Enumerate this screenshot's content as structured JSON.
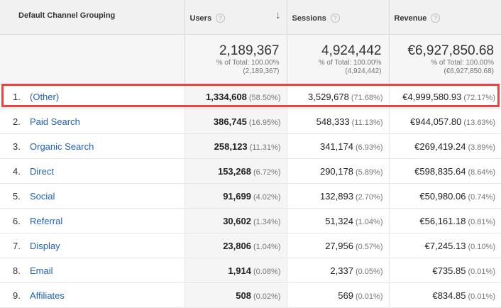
{
  "header": {
    "dimension": "Default Channel Grouping",
    "users": "Users",
    "sessions": "Sessions",
    "revenue": "Revenue",
    "help_glyph": "?",
    "sort_glyph": "↓"
  },
  "totals": {
    "users": {
      "value": "2,189,367",
      "pct": "% of Total: 100.00%",
      "abs": "(2,189,367)"
    },
    "sessions": {
      "value": "4,924,442",
      "pct": "% of Total: 100.00%",
      "abs": "(4,924,442)"
    },
    "revenue": {
      "value": "€6,927,850.68",
      "pct": "% of Total: 100.00%",
      "abs": "(€6,927,850.68)"
    }
  },
  "rows": [
    {
      "num": "1.",
      "channel": "(Other)",
      "users": "1,334,608",
      "users_pct": "(58.50%)",
      "sessions": "3,529,678",
      "sessions_pct": "(71.68%)",
      "revenue": "€4,999,580.93",
      "revenue_pct": "(72.17%)"
    },
    {
      "num": "2.",
      "channel": "Paid Search",
      "users": "386,745",
      "users_pct": "(16.95%)",
      "sessions": "548,333",
      "sessions_pct": "(11.13%)",
      "revenue": "€944,057.80",
      "revenue_pct": "(13.63%)"
    },
    {
      "num": "3.",
      "channel": "Organic Search",
      "users": "258,123",
      "users_pct": "(11.31%)",
      "sessions": "341,174",
      "sessions_pct": "(6.93%)",
      "revenue": "€269,419.24",
      "revenue_pct": "(3.89%)"
    },
    {
      "num": "4.",
      "channel": "Direct",
      "users": "153,268",
      "users_pct": "(6.72%)",
      "sessions": "290,178",
      "sessions_pct": "(5.89%)",
      "revenue": "€598,835.64",
      "revenue_pct": "(8.64%)"
    },
    {
      "num": "5.",
      "channel": "Social",
      "users": "91,699",
      "users_pct": "(4.02%)",
      "sessions": "132,893",
      "sessions_pct": "(2.70%)",
      "revenue": "€50,980.06",
      "revenue_pct": "(0.74%)"
    },
    {
      "num": "6.",
      "channel": "Referral",
      "users": "30,602",
      "users_pct": "(1.34%)",
      "sessions": "51,324",
      "sessions_pct": "(1.04%)",
      "revenue": "€56,161.18",
      "revenue_pct": "(0.81%)"
    },
    {
      "num": "7.",
      "channel": "Display",
      "users": "23,806",
      "users_pct": "(1.04%)",
      "sessions": "27,956",
      "sessions_pct": "(0.57%)",
      "revenue": "€7,245.13",
      "revenue_pct": "(0.10%)"
    },
    {
      "num": "8.",
      "channel": "Email",
      "users": "1,914",
      "users_pct": "(0.08%)",
      "sessions": "2,337",
      "sessions_pct": "(0.05%)",
      "revenue": "€735.85",
      "revenue_pct": "(0.01%)"
    },
    {
      "num": "9.",
      "channel": "Affiliates",
      "users": "508",
      "users_pct": "(0.02%)",
      "sessions": "569",
      "sessions_pct": "(0.01%)",
      "revenue": "€834.85",
      "revenue_pct": "(0.01%)"
    }
  ],
  "colors": {
    "link": "#1f5fbf",
    "highlight": "#e84545",
    "header_bg": "#f1f1f1"
  }
}
